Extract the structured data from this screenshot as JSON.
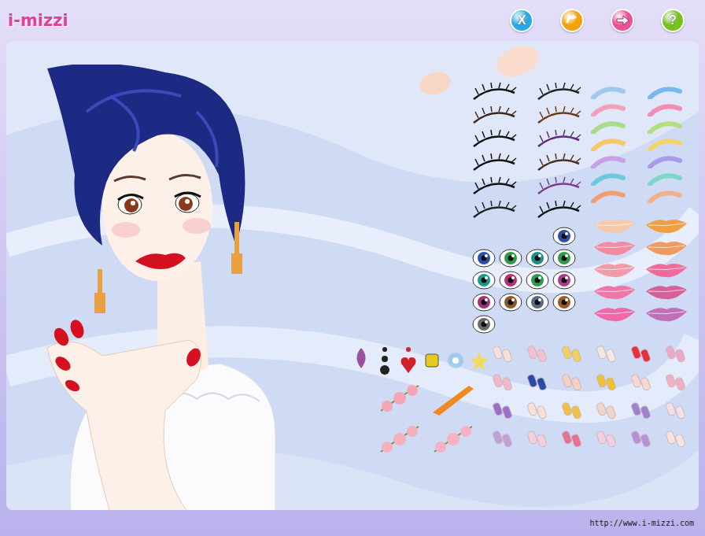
{
  "logo": {
    "text": "i-mizzi"
  },
  "toolbar": [
    {
      "label": "X",
      "kind": "text",
      "color": "#2aa8e6"
    },
    {
      "kind": "undo",
      "color": "#f3a20a"
    },
    {
      "kind": "next",
      "color": "#ee4f98"
    },
    {
      "label": "?",
      "kind": "text",
      "color": "#76c11c"
    }
  ],
  "palette": {
    "blush": [
      "#f6d6c4",
      "#f9dccd"
    ],
    "lashes": [
      "#111111",
      "#222222",
      "#3a2a1a",
      "#6b3b1a",
      "#111111",
      "#5b2d7a",
      "#111111",
      "#4a3020",
      "#111111",
      "#7a3d8f",
      "#222222",
      "#111111"
    ],
    "shadows": [
      "#9ec8ee",
      "#f2a2b8",
      "#a6dc8a",
      "#f6c868",
      "#c8a0e6",
      "#6ec8e0",
      "#f0a070",
      "#78b8f0",
      "#f28cb0",
      "#b2e07a",
      "#f5d36a",
      "#a89ce8",
      "#7fd6c8",
      "#f4b088"
    ],
    "eyes": [
      "#2d4fa8",
      "#2d4fa8",
      "#2e9b4a",
      "#1f8d86",
      "#2e9b4a",
      "#1a9a8c",
      "#b8307a",
      "#2e9b4a",
      "#b03a8a",
      "#a0307a",
      "#8a5a2a",
      "#5a6a80",
      "#9a5a2a",
      "#6a6a6a"
    ],
    "lips": [
      "#f6c9a8",
      "#f0a040",
      "#f28aa0",
      "#f09a60",
      "#f29aa8",
      "#f06a9a",
      "#ef77a8",
      "#d8609a",
      "#f068a8",
      "#c070b8"
    ],
    "accessories": [
      {
        "kind": "leaf",
        "color": "#9a4fa0"
      },
      {
        "kind": "drop",
        "color": "#222222"
      },
      {
        "kind": "heart",
        "color": "#d0202e"
      },
      {
        "kind": "square",
        "color": "#e8c818"
      },
      {
        "kind": "flower",
        "color": "#7ec0ea"
      },
      {
        "kind": "star",
        "color": "#f0dc58"
      }
    ],
    "clips": [
      {
        "kind": "flowers",
        "color": "#f4a6b6"
      },
      {
        "kind": "bar",
        "color": "#f08a20"
      },
      {
        "kind": "flowers",
        "color": "#f4b0bc"
      },
      {
        "kind": "flowers",
        "color": "#f6b2c0"
      }
    ],
    "nails": [
      "#f4e0d8",
      "#f2c0d0",
      "#f0d060",
      "#f2e8e0",
      "#e83040",
      "#f0a8c8",
      "#f0b8c8",
      "#2a4aa8",
      "#f4d0c0",
      "#f0c030",
      "#f6d8d0",
      "#f0b0c0",
      "#9a70c8",
      "#f6e0d8",
      "#f0c040",
      "#f2d4c8",
      "#a080d0",
      "#f0e0e8",
      "#c0a0d8",
      "#f4d0d8",
      "#e87090",
      "#f0d0e0",
      "#b890d8",
      "#f6e4dc"
    ]
  },
  "footer": {
    "url": "http://www.i-mizzi.com"
  }
}
